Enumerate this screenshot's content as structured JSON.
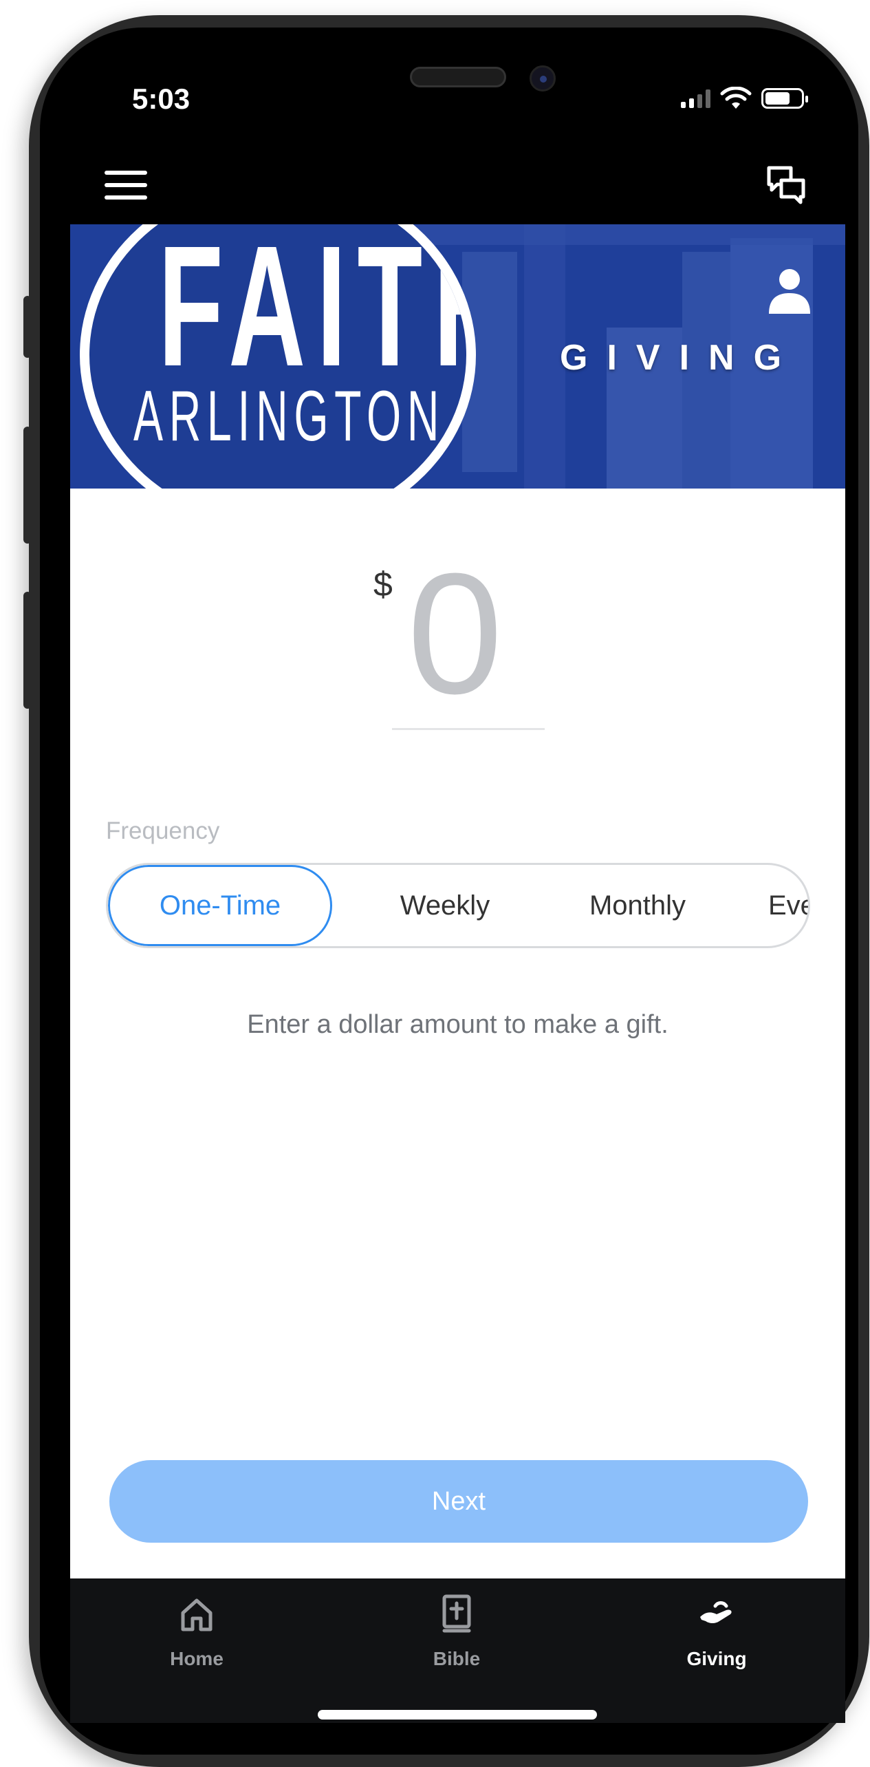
{
  "status_bar": {
    "time": "5:03"
  },
  "header": {
    "menu_icon": "hamburger-menu-icon",
    "chat_icon": "chat-bubbles-icon"
  },
  "banner": {
    "logo_word1": "FAITH",
    "logo_word2": "ARLINGTON",
    "title": "GIVING",
    "profile_icon": "person-icon",
    "brand_color": "#1f3f9a"
  },
  "amount": {
    "currency_symbol": "$",
    "value": "0"
  },
  "frequency": {
    "label": "Frequency",
    "options": [
      "One-Time",
      "Weekly",
      "Monthly",
      "Eve"
    ],
    "selected": "One-Time",
    "accent_color": "#2f8cf0"
  },
  "hint": "Enter a dollar amount to make a gift.",
  "next_button": {
    "label": "Next",
    "color": "#8cbffa"
  },
  "tabs": [
    {
      "label": "Home",
      "icon": "home-icon"
    },
    {
      "label": "Bible",
      "icon": "bible-icon"
    },
    {
      "label": "Giving",
      "icon": "giving-hand-icon",
      "active": true
    }
  ]
}
